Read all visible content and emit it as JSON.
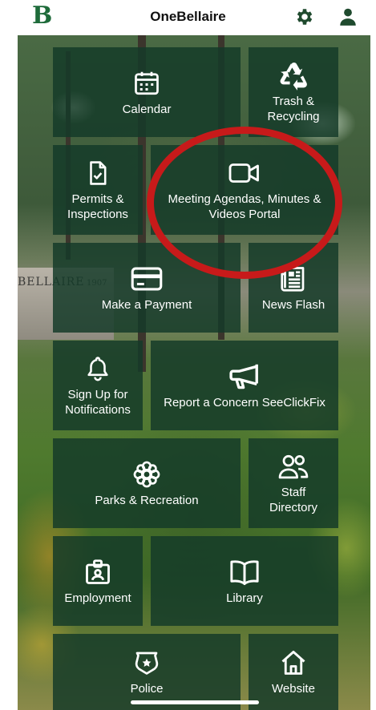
{
  "header": {
    "logo_letter": "B",
    "title": "OneBellaire",
    "settings_icon": "gear-icon",
    "account_icon": "person-icon"
  },
  "background": {
    "wall_text": "BELLAIRE",
    "wall_year": "1907"
  },
  "tiles": {
    "calendar": {
      "label": "Calendar",
      "icon": "calendar-icon"
    },
    "trash": {
      "label": "Trash &\nRecycling",
      "icon": "recycle-icon"
    },
    "permits": {
      "label": "Permits &\nInspections",
      "icon": "document-check-icon"
    },
    "meeting": {
      "label": "Meeting Agendas, Minutes &\nVideos Portal",
      "icon": "video-camera-icon"
    },
    "payment": {
      "label": "Make a Payment",
      "icon": "credit-card-icon"
    },
    "news": {
      "label": "News Flash",
      "icon": "newspaper-icon"
    },
    "notifications": {
      "label": "Sign Up for\nNotifications",
      "icon": "bell-icon"
    },
    "concern": {
      "label": "Report a Concern SeeClickFix",
      "icon": "megaphone-icon"
    },
    "parks": {
      "label": "Parks & Recreation",
      "icon": "flower-icon"
    },
    "staff": {
      "label": "Staff\nDirectory",
      "icon": "people-icon"
    },
    "employment": {
      "label": "Employment",
      "icon": "id-badge-icon"
    },
    "library": {
      "label": "Library",
      "icon": "book-icon"
    },
    "police": {
      "label": "Police",
      "icon": "police-badge-icon"
    },
    "website": {
      "label": "Website",
      "icon": "home-icon"
    }
  },
  "colors": {
    "brand_green": "#1e6b3a",
    "tile_green": "#143a28",
    "annotation_red": "#c71a1a"
  }
}
